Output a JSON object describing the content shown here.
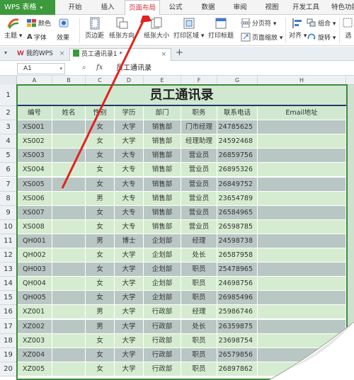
{
  "app": {
    "logo": "WPS 表格",
    "caret": "▾"
  },
  "menu": {
    "tabs": [
      "开始",
      "插入",
      "页面布局",
      "公式",
      "数据",
      "审阅",
      "视图",
      "开发工具",
      "特色功能"
    ],
    "active": "页面布局"
  },
  "ribbon": {
    "theme": "主题",
    "colors": "颜色",
    "fonts": "字体",
    "effects": "效果",
    "margins": "页边距",
    "orientation": "纸张方向",
    "size": "纸张大小",
    "print_area": "打印区域",
    "print_titles": "打印标题",
    "page_break": "分页符",
    "page_scale": "页面缩放",
    "align": "对齐",
    "group": "组合",
    "rotate": "旋转",
    "select": "选"
  },
  "doc_tabs": [
    {
      "label": "我的WPS"
    },
    {
      "label": "员工通讯录1 *"
    }
  ],
  "formula_bar": {
    "cell_ref": "A1",
    "fx": "fx",
    "content": "员工通讯录"
  },
  "columns": [
    "A",
    "B",
    "C",
    "D",
    "E",
    "F",
    "G",
    "H"
  ],
  "sheet": {
    "title": "员工通讯录",
    "headers": [
      "编号",
      "姓名",
      "性别",
      "学历",
      "部门",
      "职务",
      "联系电话",
      "Email地址"
    ],
    "rows": [
      [
        "XS001",
        "",
        "女",
        "大学",
        "销售部",
        "门市经理",
        "24785625",
        ""
      ],
      [
        "XS002",
        "",
        "女",
        "大学",
        "销售部",
        "经理助理",
        "24592468",
        ""
      ],
      [
        "XS003",
        "",
        "女",
        "大专",
        "销售部",
        "营业员",
        "26859756",
        ""
      ],
      [
        "XS004",
        "",
        "女",
        "大专",
        "销售部",
        "营业员",
        "26895326",
        ""
      ],
      [
        "XS005",
        "",
        "女",
        "大专",
        "销售部",
        "营业员",
        "26849752",
        ""
      ],
      [
        "XS006",
        "",
        "男",
        "大专",
        "销售部",
        "营业员",
        "23654789",
        ""
      ],
      [
        "XS007",
        "",
        "女",
        "大专",
        "销售部",
        "营业员",
        "26584965",
        ""
      ],
      [
        "XS008",
        "",
        "女",
        "大专",
        "销售部",
        "营业员",
        "26598785",
        ""
      ],
      [
        "QH001",
        "",
        "男",
        "博士",
        "企划部",
        "经理",
        "24598738",
        ""
      ],
      [
        "QH002",
        "",
        "女",
        "大学",
        "企划部",
        "处长",
        "26587958",
        ""
      ],
      [
        "QH003",
        "",
        "女",
        "大学",
        "企划部",
        "职员",
        "25478965",
        ""
      ],
      [
        "QH004",
        "",
        "女",
        "大学",
        "企划部",
        "职员",
        "24698756",
        ""
      ],
      [
        "QH005",
        "",
        "女",
        "大学",
        "企划部",
        "职员",
        "26985496",
        ""
      ],
      [
        "XZ001",
        "",
        "男",
        "大学",
        "行政部",
        "经理",
        "25986746",
        ""
      ],
      [
        "XZ002",
        "",
        "男",
        "大学",
        "行政部",
        "处长",
        "26359875",
        ""
      ],
      [
        "XZ003",
        "",
        "女",
        "大学",
        "行政部",
        "职员",
        "23698754",
        ""
      ],
      [
        "XZ004",
        "",
        "女",
        "大学",
        "行政部",
        "职员",
        "26579856",
        ""
      ],
      [
        "XZ005",
        "",
        "女",
        "大学",
        "行政部",
        "职员",
        "26897862",
        ""
      ]
    ]
  },
  "colors": {
    "title_bg": "#d0e8d0",
    "header_bg": "#d0e8d0",
    "row_even": "#b9c7c4",
    "row_odd": "#d6ecd0",
    "border": "#3a8a3a",
    "accent": "#d13438"
  }
}
